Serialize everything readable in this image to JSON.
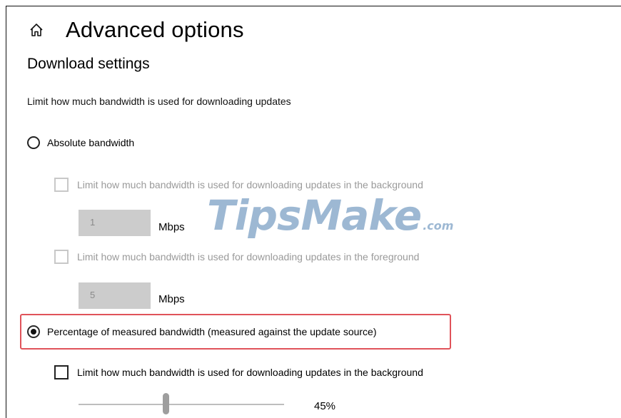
{
  "header": {
    "title": "Advanced options",
    "home_icon": "home-icon"
  },
  "section": {
    "title": "Download settings"
  },
  "description": "Limit how much bandwidth is used for downloading updates",
  "absolute": {
    "label": "Absolute bandwidth",
    "selected": false,
    "background": {
      "label": "Limit how much bandwidth is used for downloading updates in the background",
      "checked": false,
      "enabled": false,
      "value": "1",
      "unit": "Mbps"
    },
    "foreground": {
      "label": "Limit how much bandwidth is used for downloading updates in the foreground",
      "checked": false,
      "enabled": false,
      "value": "5",
      "unit": "Mbps"
    }
  },
  "percentage": {
    "label": "Percentage of measured bandwidth (measured against the update source)",
    "selected": true,
    "background": {
      "label": "Limit how much bandwidth is used for downloading updates in the background",
      "checked": false,
      "enabled": true,
      "slider_value": 45,
      "slider_label": "45%"
    }
  },
  "watermark": {
    "brand": "TipsMake",
    "domain": ".com"
  },
  "colors": {
    "highlight": "#e0535a",
    "watermark": "#4e7fb0",
    "disabled_text": "#9a9a9a"
  }
}
